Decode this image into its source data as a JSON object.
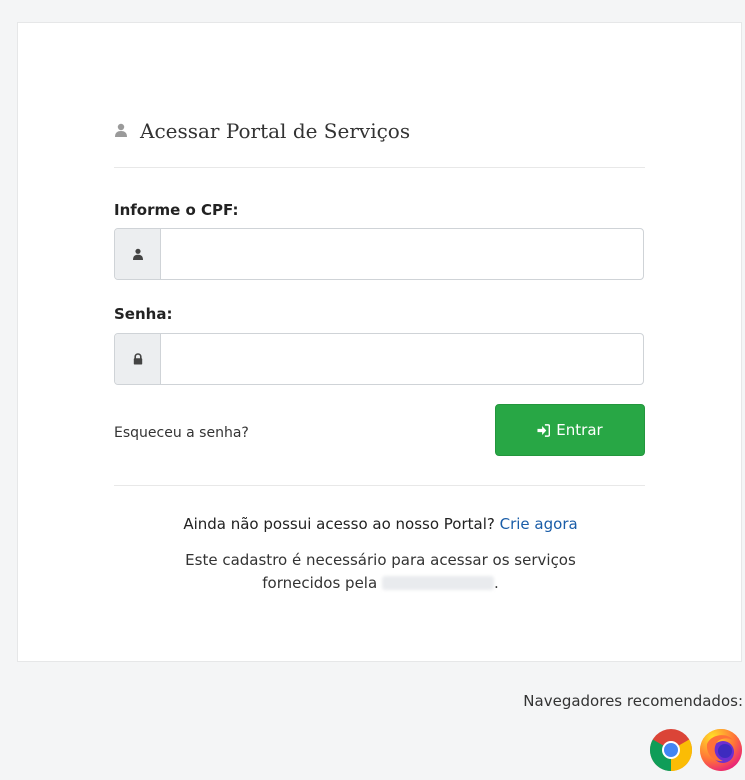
{
  "login": {
    "title": "Acessar Portal de Serviços",
    "cpf_label": "Informe o CPF:",
    "cpf_value": "",
    "password_label": "Senha:",
    "password_value": "",
    "forgot_link": "Esqueceu a senha?",
    "enter_button": "Entrar"
  },
  "signup": {
    "question": "Ainda não possui acesso ao nosso Portal?",
    "link": "Crie agora",
    "info_line1": "Este cadastro é necessário para acessar os serviços",
    "info_line2_prefix": "fornecidos pela",
    "info_line2_suffix": "."
  },
  "footer": {
    "browsers_label": "Navegadores recomendados:",
    "browsers": [
      "chrome-icon",
      "firefox-icon"
    ]
  },
  "colors": {
    "primary_button": "#28a745",
    "link": "#1a5da8",
    "page_bg": "#f4f5f6"
  }
}
